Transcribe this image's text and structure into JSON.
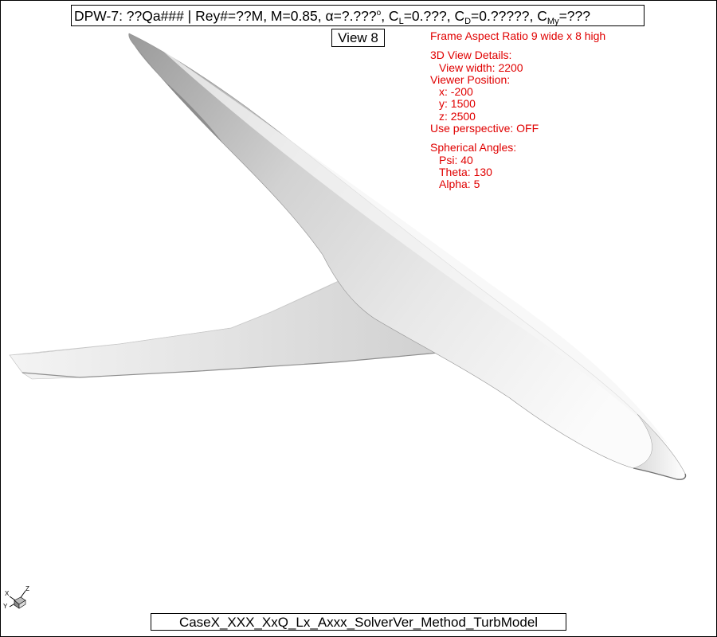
{
  "header": {
    "prefix": "DPW-7: ??Qa### | Rey#=??M, M=0.85, α=?.???",
    "degree": "o",
    "cl_pre": ", C",
    "cl_sub": "L",
    "cl_val": "=0.???",
    "cd_pre": ", C",
    "cd_sub": "D",
    "cd_val": "=0.?????",
    "cm_pre": ", C",
    "cm_sub": "My",
    "cm_val": "=???"
  },
  "view_label": "View 8",
  "info": {
    "aspect": "Frame Aspect Ratio 9 wide x 8 high",
    "details_title": "3D View Details:",
    "view_width": "View width: 2200",
    "viewer_position": "Viewer Position:",
    "x": "x: -200",
    "y": "y: 1500",
    "z": "z: 2500",
    "perspective": "Use perspective: OFF",
    "angles_title": "Spherical Angles:",
    "psi": "Psi: 40",
    "theta": "Theta: 130",
    "alpha": "Alpha: 5"
  },
  "footer": "CaseX_XXX_XxQ_Lx_Axxx_SolverVer_Method_TurbModel",
  "axis_triad": {
    "x": "X",
    "y": "Y",
    "z": "Z"
  },
  "colors": {
    "annotation": "#e00000",
    "surface": "#dcdcdc",
    "background": "#ffffff"
  }
}
